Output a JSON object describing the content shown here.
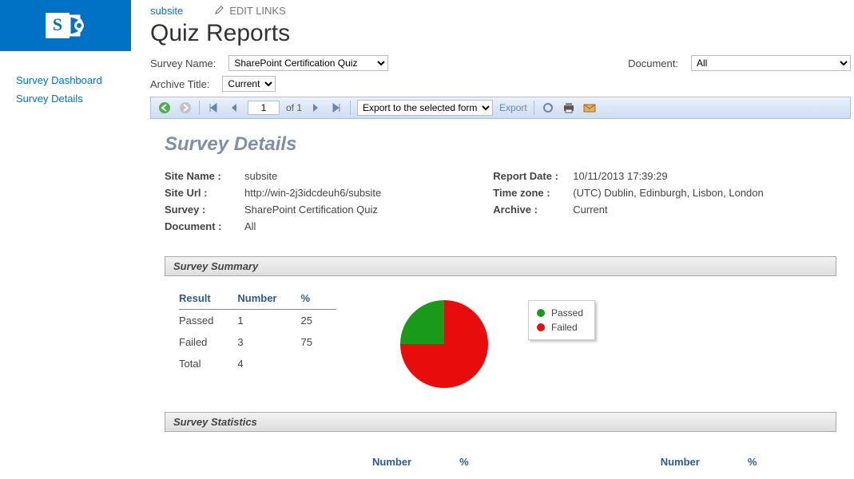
{
  "topnav": {
    "subsite": "subsite",
    "edit_links": "EDIT LINKS"
  },
  "page_title": "Quiz Reports",
  "leftnav": {
    "dashboard": "Survey Dashboard",
    "details": "Survey Details"
  },
  "filters": {
    "survey_label": "Survey Name:",
    "survey_value": "SharePoint Certification Quiz",
    "archive_label": "Archive Title:",
    "archive_value": "Current",
    "document_label": "Document:",
    "document_value": "All"
  },
  "toolbar": {
    "page_value": "1",
    "page_of": "of 1",
    "export_select": "Export to the selected format",
    "export_link": "Export"
  },
  "report": {
    "title": "Survey Details",
    "meta_left": {
      "site_name_l": "Site Name :",
      "site_name_v": "subsite",
      "site_url_l": "Site Url :",
      "site_url_v": "http://win-2j3idcdeuh6/subsite",
      "survey_l": "Survey :",
      "survey_v": "SharePoint Certification Quiz",
      "document_l": "Document :",
      "document_v": "All"
    },
    "meta_right": {
      "report_date_l": "Report Date :",
      "report_date_v": "10/11/2013 17:39:29",
      "tz_l": "Time zone :",
      "tz_v": "(UTC) Dublin, Edinburgh, Lisbon, London",
      "archive_l": "Archive :",
      "archive_v": "Current"
    },
    "summary_header": "Survey Summary",
    "summary_table": {
      "h_result": "Result",
      "h_number": "Number",
      "h_pct": "%",
      "rows": [
        {
          "result": "Passed",
          "number": "1",
          "pct": "25"
        },
        {
          "result": "Failed",
          "number": "3",
          "pct": "75"
        },
        {
          "result": "Total",
          "number": "4",
          "pct": ""
        }
      ]
    },
    "legend": {
      "passed": "Passed",
      "failed": "Failed"
    },
    "stats_header": "Survey Statistics",
    "stats_cols": {
      "number": "Number",
      "pct": "%"
    }
  },
  "chart_data": {
    "type": "pie",
    "title": "Survey Summary",
    "series": [
      {
        "name": "Passed",
        "value": 25,
        "color": "#1a9a1a"
      },
      {
        "name": "Failed",
        "value": 75,
        "color": "#e80c0c"
      }
    ]
  }
}
